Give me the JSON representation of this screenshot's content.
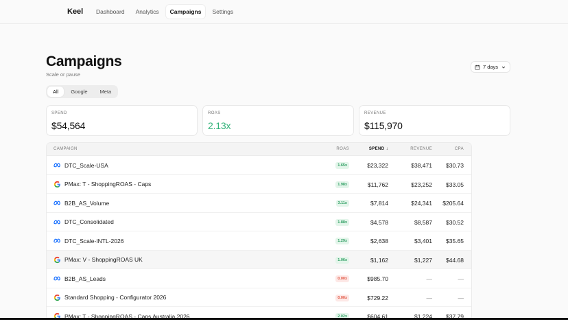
{
  "nav": {
    "brand": "Keel",
    "items": [
      "Dashboard",
      "Analytics",
      "Campaigns",
      "Settings"
    ],
    "active": "Campaigns"
  },
  "header": {
    "title": "Campaigns",
    "subtitle": "Scale or pause",
    "range_label": "7 days"
  },
  "filters": [
    "All",
    "Google",
    "Meta"
  ],
  "stats": [
    {
      "label": "SPEND",
      "value": "$54,564"
    },
    {
      "label": "ROAS",
      "value": "2.13x"
    },
    {
      "label": "REVENUE",
      "value": "$115,970"
    }
  ],
  "table": {
    "columns": {
      "campaign": "CAMPAIGN",
      "roas": "ROAS",
      "spend": "SPEND",
      "revenue": "REVENUE",
      "cpa": "CPA"
    },
    "rows": [
      {
        "platform": "meta",
        "name": "DTC_Scale-USA",
        "roas": "1.65x",
        "spend": "$23,322",
        "revenue": "$38,471",
        "cpa": "$30.73"
      },
      {
        "platform": "google",
        "name": "PMax: T - ShoppingROAS - Caps",
        "roas": "1.98x",
        "spend": "$11,762",
        "revenue": "$23,252",
        "cpa": "$33.05"
      },
      {
        "platform": "meta",
        "name": "B2B_AS_Volume",
        "roas": "3.11x",
        "spend": "$7,814",
        "revenue": "$24,341",
        "cpa": "$205.64"
      },
      {
        "platform": "meta",
        "name": "DTC_Consolidated",
        "roas": "1.88x",
        "spend": "$4,578",
        "revenue": "$8,587",
        "cpa": "$30.52"
      },
      {
        "platform": "meta",
        "name": "DTC_Scale-INTL-2026",
        "roas": "1.29x",
        "spend": "$2,638",
        "revenue": "$3,401",
        "cpa": "$35.65"
      },
      {
        "platform": "google",
        "name": "PMax: V - ShoppingROAS UK",
        "roas": "1.06x",
        "spend": "$1,162",
        "revenue": "$1,227",
        "cpa": "$44.68"
      },
      {
        "platform": "meta",
        "name": "B2B_AS_Leads",
        "roas": "0.00x",
        "spend": "$985.70",
        "revenue": "—",
        "cpa": "—"
      },
      {
        "platform": "google",
        "name": "Standard Shopping - Configurator 2026",
        "roas": "0.00x",
        "spend": "$729.22",
        "revenue": "—",
        "cpa": "—"
      },
      {
        "platform": "google",
        "name": "PMax: T - ShoppingROAS - Caps Australia 2026",
        "roas": "2.02x",
        "spend": "$604.61",
        "revenue": "$1,224",
        "cpa": "$37.79"
      }
    ]
  },
  "colors": {
    "roas_positive": "#33b37a",
    "badge_negative": "#e0533f",
    "meta_blue": "#0866ff"
  }
}
